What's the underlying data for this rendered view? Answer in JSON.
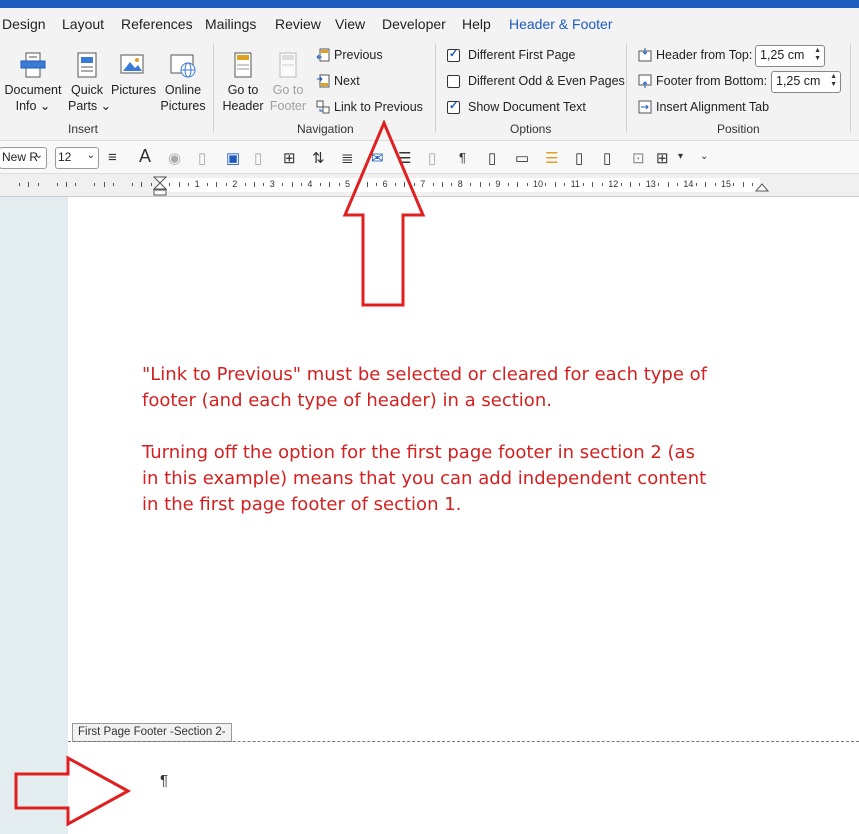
{
  "tabs": [
    "Design",
    "Layout",
    "References",
    "Mailings",
    "Review",
    "View",
    "Developer",
    "Help",
    "Header & Footer"
  ],
  "active_tab": "Header & Footer",
  "ribbon": {
    "insert": {
      "label": "Insert",
      "document_info": [
        "Document",
        "Info ⌄"
      ],
      "quick_parts": [
        "Quick",
        "Parts ⌄"
      ],
      "pictures": "Pictures",
      "online_pictures": [
        "Online",
        "Pictures"
      ]
    },
    "navigation": {
      "label": "Navigation",
      "go_to_header": [
        "Go to",
        "Header"
      ],
      "go_to_footer": [
        "Go to",
        "Footer"
      ],
      "previous": "Previous",
      "next": "Next",
      "link_to_previous": "Link to Previous"
    },
    "options": {
      "label": "Options",
      "different_first_page": "Different First Page",
      "different_first_page_checked": true,
      "different_odd_even": "Different Odd & Even Pages",
      "different_odd_even_checked": false,
      "show_document_text": "Show Document Text",
      "show_document_text_checked": true
    },
    "position": {
      "label": "Position",
      "header_from_top_label": "Header from Top:",
      "header_from_top_value": "1,25 cm",
      "footer_from_bottom_label": "Footer from Bottom:",
      "footer_from_bottom_value": "1,25 cm",
      "insert_alignment_tab": "Insert Alignment Tab"
    }
  },
  "toolbar": {
    "font_name": "New R",
    "font_size": "12"
  },
  "ruler": {
    "labels": [
      "1",
      "2",
      "3",
      "4",
      "5",
      "6",
      "7",
      "8",
      "9",
      "10",
      "11",
      "12",
      "13",
      "14",
      "15"
    ]
  },
  "annotation": {
    "line1": "\"Link to Previous\" must be selected or cleared for each type of",
    "line2": "footer (and each type of header) in a section.",
    "line3": "Turning off the option for the first page footer in section 2 (as",
    "line4": "in this example) means that you can add independent content",
    "line5": "in the first page footer of section 1."
  },
  "footer": {
    "label": "First Page Footer -Section 2-",
    "pilcrow": "¶"
  },
  "colors": {
    "accent": "#1d5bbf",
    "annotation": "#d42020"
  }
}
